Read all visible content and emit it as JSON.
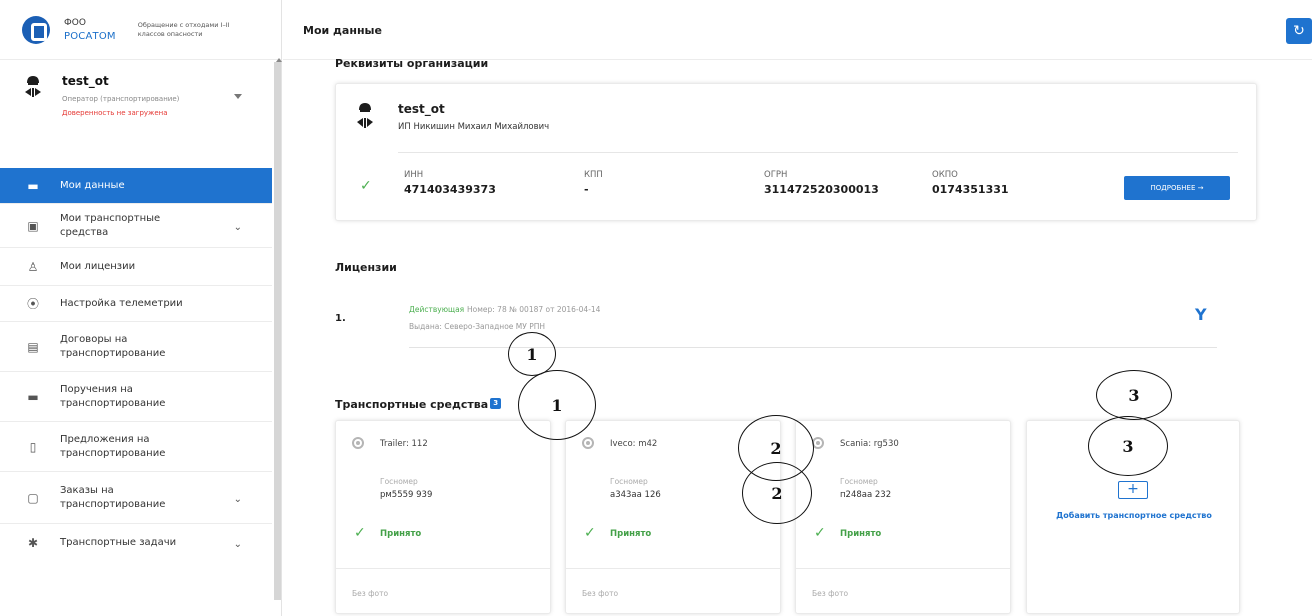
{
  "sidebar": {
    "logo": {
      "line1": "ФОО",
      "brand": "РОСАТОМ",
      "subtitle": "Обращение с отходами I–II классов опасности"
    },
    "user": {
      "name": "test_ot",
      "role": "Оператор (транспортирование)",
      "warning": "Доверенность не загружена"
    },
    "items": [
      {
        "label": "Мои данные",
        "icon": "folder-icon",
        "active": true
      },
      {
        "label": "Мои транспортные средства",
        "icon": "truck-icon",
        "expandable": true
      },
      {
        "label": "Мои лицензии",
        "icon": "award-icon"
      },
      {
        "label": "Настройка телеметрии",
        "icon": "signal-icon"
      },
      {
        "label": "Договоры на транспортирование",
        "icon": "document-icon"
      },
      {
        "label": "Поручения на транспортирование",
        "icon": "briefcase-icon"
      },
      {
        "label": "Предложения на транспортирование",
        "icon": "list-icon"
      },
      {
        "label": "Заказы на транспортирование",
        "icon": "file-icon",
        "expandable": true
      },
      {
        "label": "Транспортные задачи",
        "icon": "puzzle-icon",
        "expandable": true
      }
    ]
  },
  "header": {
    "title": "Мои данные",
    "refresh_icon": "refresh-icon"
  },
  "org": {
    "section_title": "Реквизиты организации",
    "name": "test_ot",
    "full_name": "ИП Никишин Михаил Михайлович",
    "fields": [
      {
        "label": "ИНН",
        "value": "471403439373"
      },
      {
        "label": "КПП",
        "value": "-"
      },
      {
        "label": "ОГРН",
        "value": "311472520300013"
      },
      {
        "label": "ОКПО",
        "value": "0174351331"
      }
    ],
    "more_button": "ПОДРОБНЕЕ →"
  },
  "licenses": {
    "section_title": "Лицензии",
    "items": [
      {
        "num": "1.",
        "status": "Действующая",
        "info": "Номер: 78 № 00187 от 2016-04-14",
        "issued": "Выдана: Северо-Западное МУ РПН"
      }
    ]
  },
  "vehicles": {
    "section_title": "Транспортные средства",
    "badge": "3",
    "plate_label": "Госномер",
    "photo_label": "Без фото",
    "items": [
      {
        "name": "Trailer: 112",
        "plate": "рм5559 939",
        "status": "Принято"
      },
      {
        "name": "Iveco: m42",
        "plate": "а343аа 126",
        "status": "Принято"
      },
      {
        "name": "Scania: rg530",
        "plate": "п248аа 232",
        "status": "Принято"
      }
    ],
    "add_label": "Добавить транспортное средство",
    "add_icon": "plus-icon"
  },
  "annotations": [
    "1",
    "1",
    "2",
    "2",
    "3",
    "3"
  ],
  "colors": {
    "accent": "#1f73cf",
    "success": "#4caf50",
    "warning": "#e53935"
  }
}
